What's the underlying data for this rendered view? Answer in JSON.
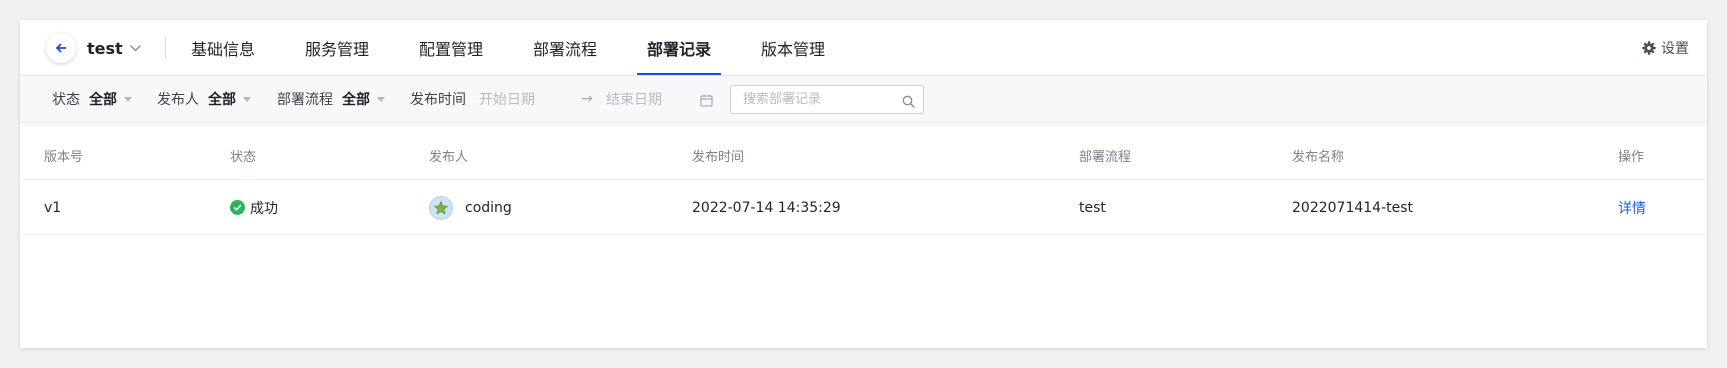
{
  "project": {
    "name": "test"
  },
  "tabs": [
    {
      "label": "基础信息"
    },
    {
      "label": "服务管理"
    },
    {
      "label": "配置管理"
    },
    {
      "label": "部署流程"
    },
    {
      "label": "部署记录",
      "active": true
    },
    {
      "label": "版本管理"
    }
  ],
  "settings": {
    "label": "设置"
  },
  "filters": {
    "status": {
      "label": "状态",
      "value": "全部"
    },
    "publisher": {
      "label": "发布人",
      "value": "全部"
    },
    "pipeline": {
      "label": "部署流程",
      "value": "全部"
    },
    "publish_time": {
      "label": "发布时间",
      "start_placeholder": "开始日期",
      "end_placeholder": "结束日期",
      "arrow": "→"
    },
    "search": {
      "placeholder": "搜索部署记录"
    }
  },
  "table": {
    "columns": [
      "版本号",
      "状态",
      "发布人",
      "发布时间",
      "部署流程",
      "发布名称",
      "操作"
    ],
    "rows": [
      {
        "version": "v1",
        "status": "成功",
        "publisher": "coding",
        "publish_time": "2022-07-14 14:35:29",
        "pipeline": "test",
        "release_name": "2022071414-test",
        "action": "详情"
      }
    ]
  },
  "colors": {
    "accent": "#1b4dd6",
    "link": "#1b5fd8",
    "success": "#2eb35a"
  },
  "icons": {
    "back": "arrow-left-icon",
    "project_dropdown": "chevron-down-icon",
    "settings": "gear-icon",
    "calendar": "calendar-icon",
    "search": "search-icon",
    "status_success": "check-circle-icon",
    "avatar": "star-avatar"
  }
}
